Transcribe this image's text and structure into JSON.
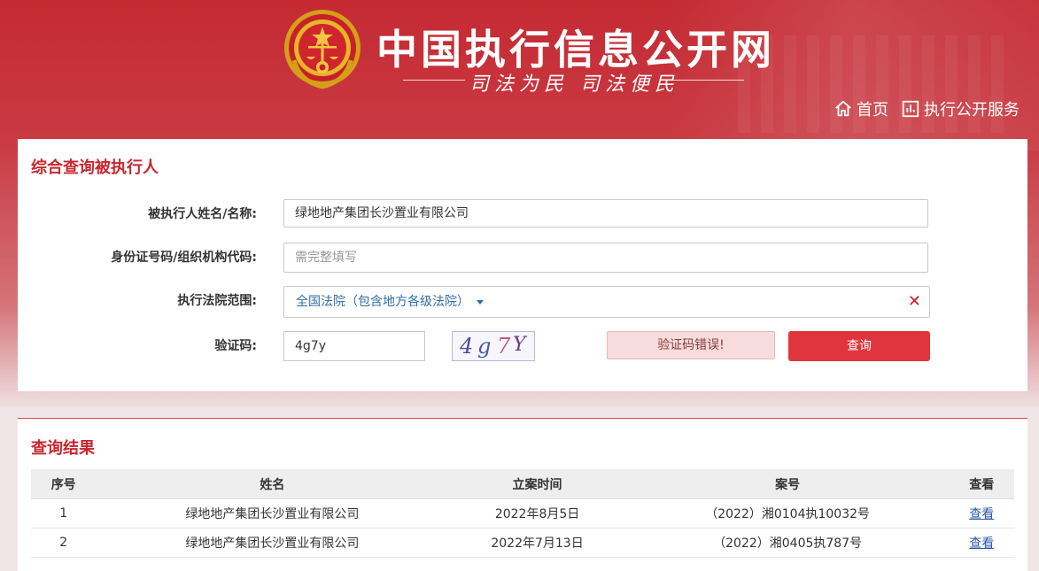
{
  "header": {
    "site_title": "中国执行信息公开网",
    "slogan": "司法为民  司法便民",
    "nav": [
      {
        "label": "首页",
        "icon": "home-icon"
      },
      {
        "label": "执行公开服务",
        "icon": "chart-icon"
      }
    ],
    "colors": {
      "brand_red": "#c52a33",
      "button_red": "#e1353d",
      "link_blue": "#2a5aa8"
    }
  },
  "search": {
    "title": "综合查询被执行人",
    "name_label": "被执行人姓名/名称:",
    "name_value": "绿地地产集团长沙置业有限公司",
    "id_label": "身份证号码/组织机构代码:",
    "id_placeholder": "需完整填写",
    "court_label": "执行法院范围:",
    "court_value": "全国法院（包含地方各级法院）",
    "captcha_label": "验证码:",
    "captcha_value": "4g7y",
    "captcha_image_chars": [
      "4",
      "g",
      "7",
      "Y"
    ],
    "captcha_error": "验证码错误!",
    "search_button": "查询"
  },
  "results": {
    "title": "查询结果",
    "columns": [
      "序号",
      "姓名",
      "立案时间",
      "案号",
      "查看"
    ],
    "rows": [
      {
        "index": "1",
        "name": "绿地地产集团长沙置业有限公司",
        "date": "2022年8月5日",
        "case_no": "（2022）湘0104执10032号",
        "view": "查看"
      },
      {
        "index": "2",
        "name": "绿地地产集团长沙置业有限公司",
        "date": "2022年7月13日",
        "case_no": "（2022）湘0405执787号",
        "view": "查看"
      }
    ]
  }
}
